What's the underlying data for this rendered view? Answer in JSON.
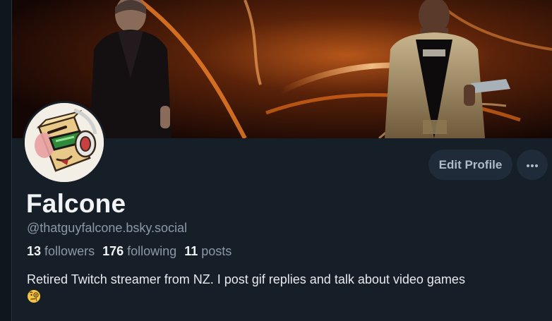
{
  "profile": {
    "display_name": "Falcone",
    "handle": "@thatguyfalcone.bsky.social",
    "stats": {
      "followers_count": "13",
      "followers_label": "followers",
      "following_count": "176",
      "following_label": "following",
      "posts_count": "11",
      "posts_label": "posts"
    },
    "bio": "Retired Twitch streamer from NZ. I post gif replies and talk about video games",
    "bio_emoji_icon": "face-with-monocle-icon"
  },
  "actions": {
    "edit_profile_label": "Edit Profile",
    "more_icon": "ellipsis-icon"
  },
  "colors": {
    "background": "#161e27",
    "button_bg": "#1f2b38",
    "text_primary": "#f1f3f5",
    "text_secondary": "#8b98a6"
  }
}
